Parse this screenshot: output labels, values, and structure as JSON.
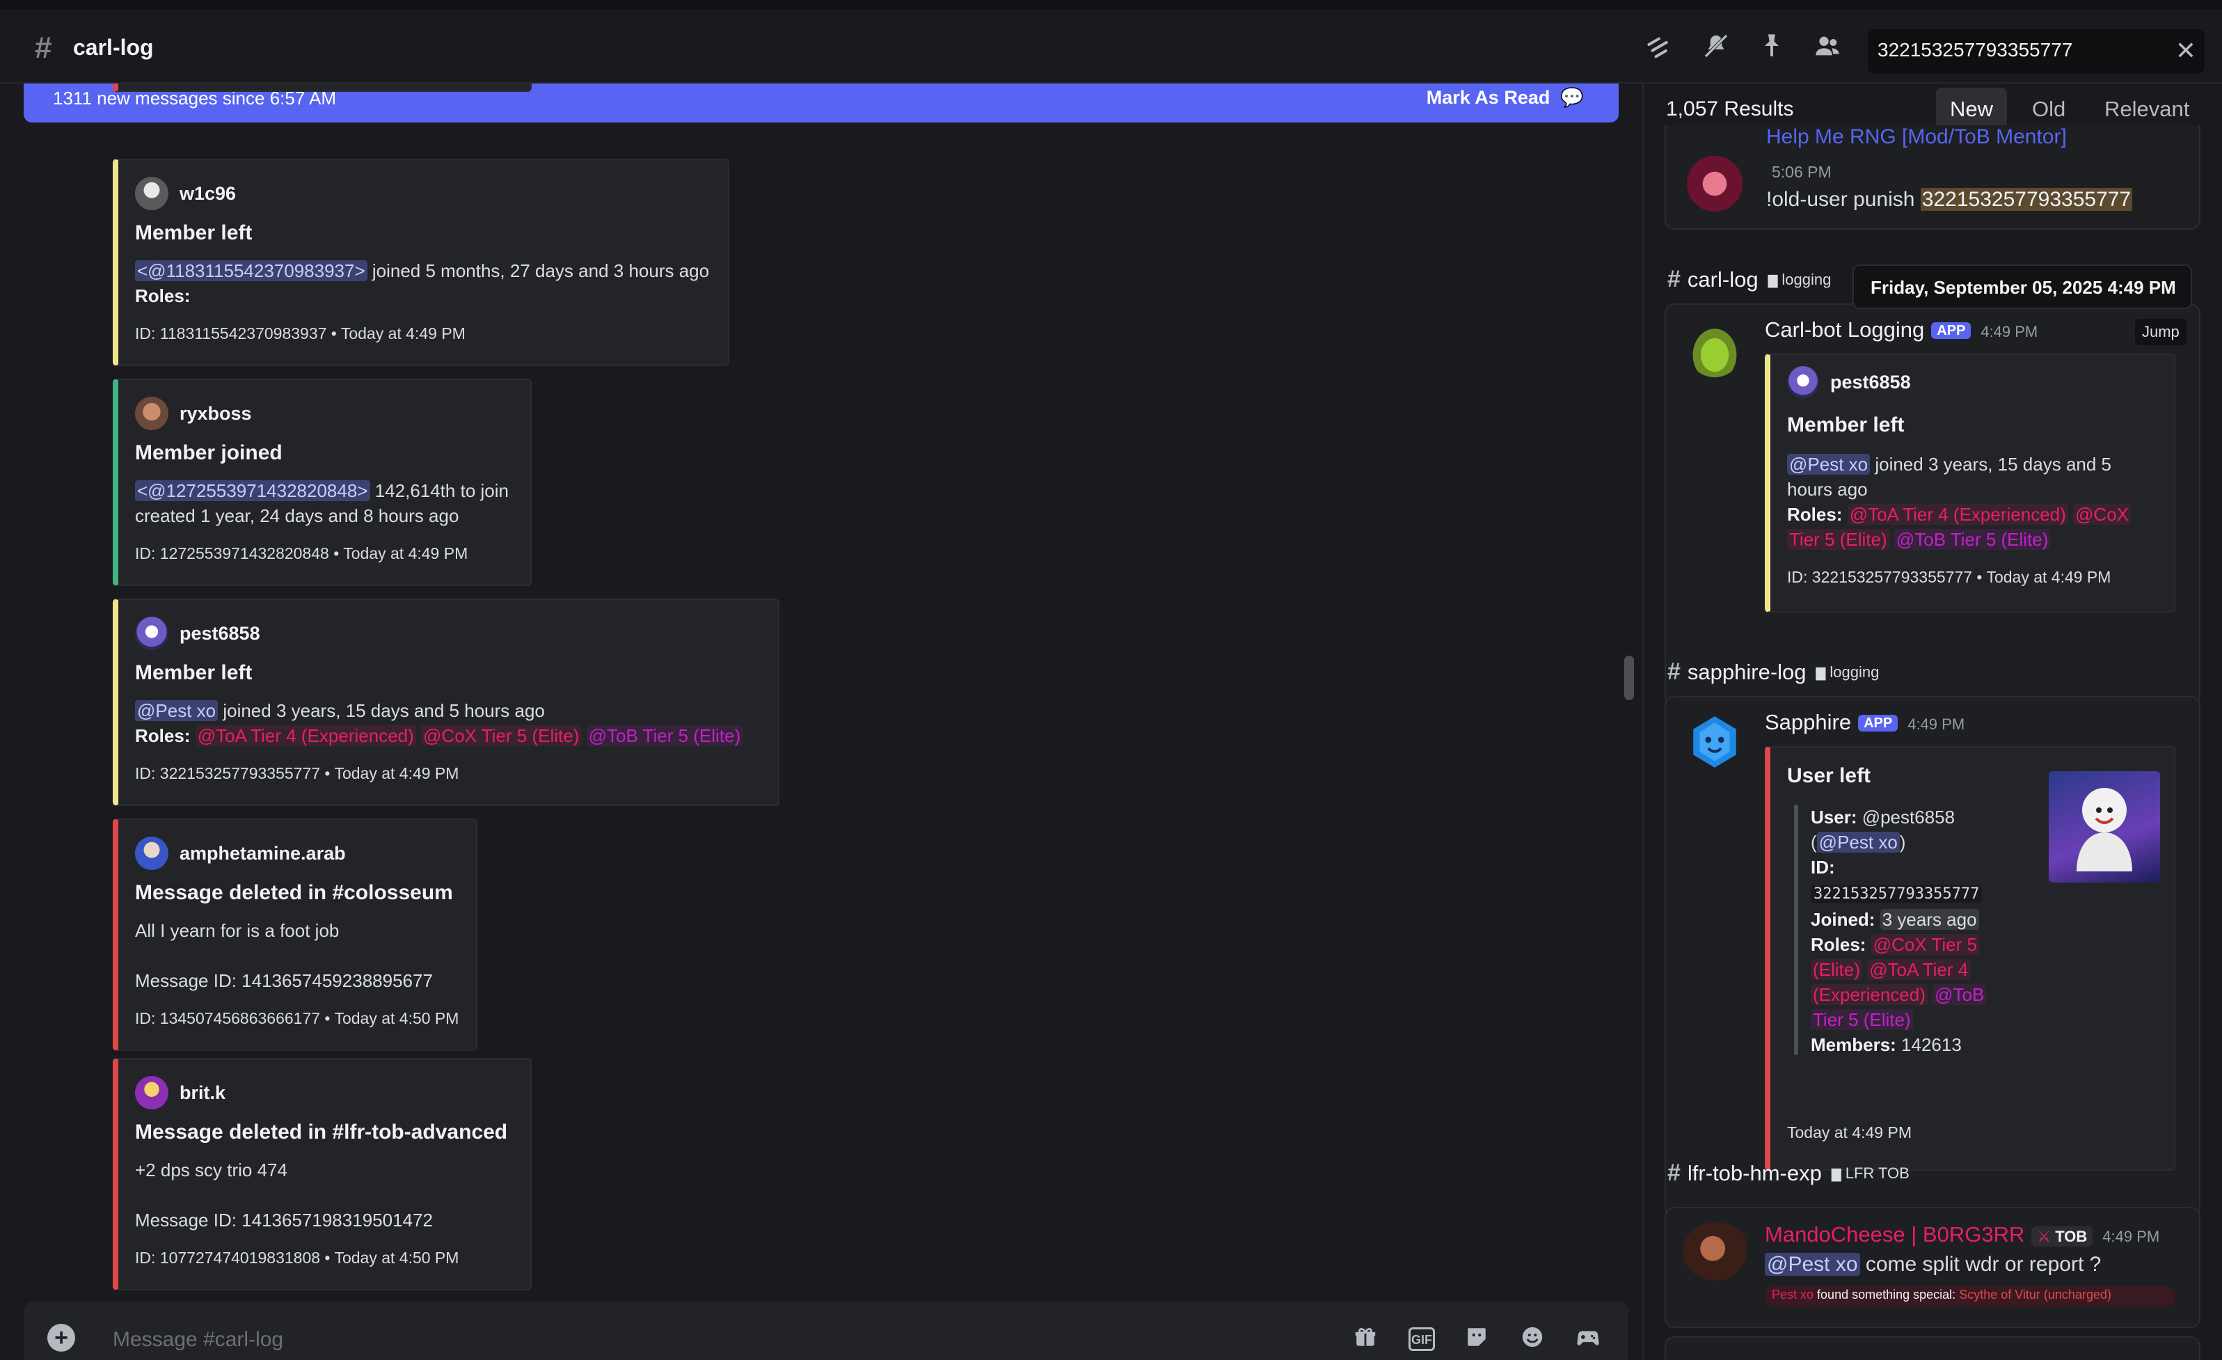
{
  "header": {
    "channel_name": "carl-log",
    "search_value": "322153257793355777",
    "icons": [
      "threads-icon",
      "mute-icon",
      "pin-icon",
      "members-icon"
    ]
  },
  "banner": {
    "text": "1311 new messages since 6:57 AM",
    "action": "Mark As Read"
  },
  "messages": [
    {
      "author": "w1c96",
      "title": "Member left",
      "mention": "<@1183115542370983937>",
      "line1_rest": " joined 5 months, 27 days and 3 hours ago",
      "roles_label": "Roles:",
      "footer": "ID: 1183115542370983937 • Today at 4:49 PM",
      "color": "#f0e68c"
    },
    {
      "author": "ryxboss",
      "title": "Member joined",
      "mention": "<@1272553971432820848>",
      "line1_rest": " 142,614th to join",
      "line2": "created 1 year, 24 days and 8 hours ago",
      "footer": "ID: 1272553971432820848 • Today at 4:49 PM",
      "color": "#43b581"
    },
    {
      "author": "pest6858",
      "title": "Member left",
      "mention": "@Pest xo",
      "line1_rest": " joined 3 years, 15 days and 5 hours ago",
      "roles_label": "Roles:",
      "roles": [
        "@ToA Tier 4 (Experienced)",
        "@CoX Tier 5 (Elite)",
        "@ToB Tier 5 (Elite)"
      ],
      "footer": "ID: 322153257793355777 • Today at 4:49 PM",
      "color": "#f0e68c"
    },
    {
      "author": "amphetamine.arab",
      "title": "Message deleted in #colosseum",
      "body": "All I yearn for is a foot job",
      "message_id": "Message ID: 1413657459238895677",
      "footer": "ID: 134507456863666177 • Today at 4:50 PM",
      "color": "#e04848"
    },
    {
      "author": "brit.k",
      "title": "Message deleted in #lfr-tob-advanced",
      "body": "+2 dps scy trio 474",
      "message_id": "Message ID: 1413657198319501472",
      "footer": "ID: 107727474019831808 • Today at 4:50 PM",
      "color": "#e04848"
    }
  ],
  "composer": {
    "placeholder": "Message #carl-log",
    "icons": [
      "gift-icon",
      "gif-icon",
      "sticker-icon",
      "emoji-icon",
      "activities-icon"
    ],
    "gif_label": "GIF"
  },
  "results": {
    "count": "1,057 Results",
    "tabs": [
      "New",
      "Old",
      "Relevant"
    ],
    "active_tab": "New",
    "top_card": {
      "name": "Help Me RNG [Mod/ToB Mentor]",
      "time": "5:06 PM",
      "text_prefix": "!old-user punish ",
      "highlight": "322153257793355777"
    },
    "tooltip": "Friday, September 05, 2025 4:49 PM",
    "jump_label": "Jump",
    "groups": [
      {
        "channel": "carl-log",
        "category": "logging",
        "author": "Carl-bot Logging",
        "badge": "APP",
        "time": "4:49 PM",
        "embed_author": "pest6858",
        "embed_title": "Member left",
        "mention": "@Pest xo",
        "line1_rest": " joined 3 years, 15 days and 5",
        "line2": "hours ago",
        "roles_label": "Roles:",
        "role1": "@ToA Tier 4 (Experienced)",
        "role2a": "@CoX",
        "role2b": "Tier 5 (Elite)",
        "role3": "@ToB Tier 5 (Elite)",
        "footer": "ID: 322153257793355777 • Today at 4:49 PM"
      },
      {
        "channel": "sapphire-log",
        "category": "logging",
        "author": "Sapphire",
        "badge": "APP",
        "time": "4:49 PM",
        "embed_title": "User left",
        "user_label": "User:",
        "user_value": " @pest6858",
        "paren_open": "(",
        "mention": "@Pest xo",
        "paren_close": ")",
        "id_label": "ID:",
        "id_value": "322153257793355777",
        "joined_label": "Joined:",
        "joined_value": "3 years ago",
        "roles_label": "Roles:",
        "role_lines": [
          "@CoX Tier 5",
          "(Elite)",
          "@ToA Tier 4",
          "(Experienced)",
          "@ToB",
          "Tier 5 (Elite)"
        ],
        "members_label": "Members:",
        "members_value": " 142613",
        "footer": "Today at 4:49 PM"
      },
      {
        "channel": "lfr-tob-hm-exp",
        "category": "LFR TOB",
        "author": "MandoCheese | B0RG3RR",
        "tag": "TOB",
        "time": "4:49 PM",
        "mention": "@Pest xo",
        "text": " come split wdr or report ?",
        "sub_prefix": "found something special: ",
        "sub_item": "Scythe of Vitur (uncharged)",
        "sub_name": "Pest xo"
      }
    ]
  }
}
